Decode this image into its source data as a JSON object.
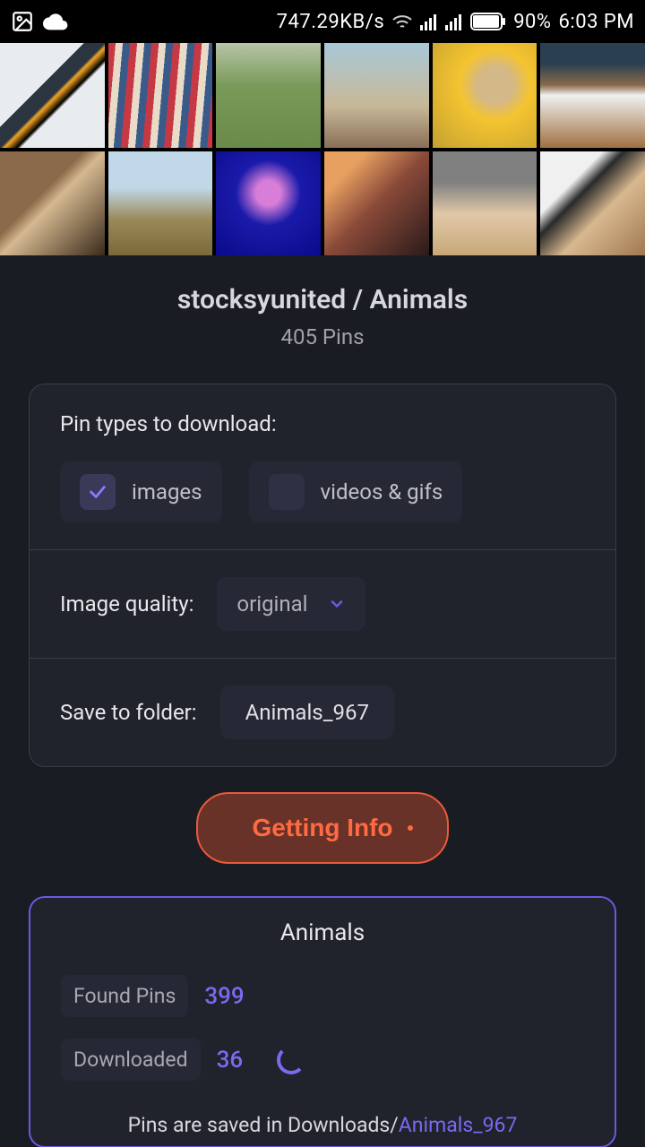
{
  "status": {
    "net_speed": "747.29KB/s",
    "battery_pct": "90%",
    "time": "6:03 PM"
  },
  "header": {
    "title": "stocksyunited / Animals",
    "pin_count": "405 Pins"
  },
  "settings": {
    "pin_types_label": "Pin types to download:",
    "opt_images": {
      "label": "images",
      "checked": true
    },
    "opt_videos": {
      "label": "videos & gifs",
      "checked": false
    },
    "quality_label": "Image quality:",
    "quality_value": "original",
    "folder_label": "Save to folder:",
    "folder_value": "Animals_967"
  },
  "action": {
    "button_label": "Getting Info"
  },
  "progress": {
    "title": "Animals",
    "found_label": "Found Pins",
    "found_value": "399",
    "downloaded_label": "Downloaded",
    "downloaded_value": "36",
    "save_prefix": "Pins are saved in Downloads/",
    "save_folder": "Animals_967"
  }
}
